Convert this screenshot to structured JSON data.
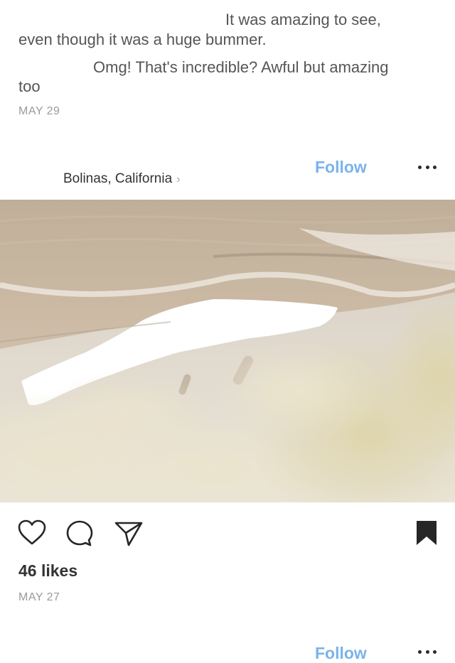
{
  "comments": {
    "line1": "It was amazing to see,",
    "line2": "even though it was a huge bummer.",
    "line3": "Omg! That's incredible?  Awful but amazing",
    "line4": "too"
  },
  "previous_post": {
    "date": "MAY 29"
  },
  "post": {
    "location": "Bolinas, California",
    "location_chevron": "›",
    "follow_label": "Follow",
    "more_icon": "ellipsis-icon",
    "likes": "46 likes",
    "date": "MAY 27",
    "icons": {
      "like": "heart-icon",
      "comment": "comment-bubble-icon",
      "share": "paper-plane-icon",
      "save": "bookmark-icon"
    }
  },
  "next_post": {
    "follow_label": "Follow"
  },
  "colors": {
    "follow_blue": "#7ab3ea",
    "muted_text": "#9a9a9a"
  }
}
